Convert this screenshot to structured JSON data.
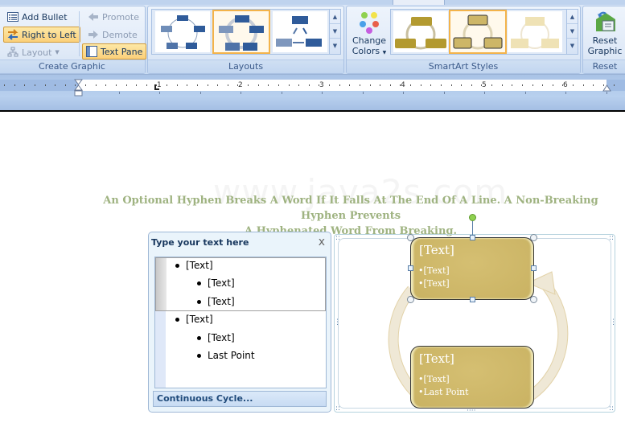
{
  "ribbon": {
    "create_graphic": {
      "label": "Create Graphic",
      "add_bullet": "Add Bullet",
      "right_to_left": "Right to Left",
      "layout": "Layout",
      "promote": "Promote",
      "demote": "Demote",
      "text_pane": "Text Pane"
    },
    "layouts": {
      "label": "Layouts",
      "thumbs": [
        "Basic Cycle",
        "Continuous Cycle",
        "Hierarchy Cycle"
      ],
      "selected_index": 1
    },
    "smartart_styles": {
      "label": "SmartArt Styles",
      "change_colors_l1": "Change",
      "change_colors_l2": "Colors",
      "thumbs": [
        "Style 1",
        "Style 2",
        "Style 3"
      ],
      "selected_index": 1
    },
    "reset": {
      "label": "Reset",
      "reset_graphic_l1": "Reset",
      "reset_graphic_l2": "Graphic"
    }
  },
  "ruler": {
    "numbers": [
      "1",
      "2",
      "3",
      "4",
      "5",
      "6"
    ]
  },
  "document": {
    "watermark": "www.java2s.com",
    "heading_line1": "An Optional Hyphen Breaks A Word If It Falls At The End Of A Line. A Non-Breaking Hyphen Prevents",
    "heading_line2": "A Hyphenated  Word From Breaking."
  },
  "text_pane": {
    "title": "Type your text here",
    "close": "x",
    "items": [
      {
        "level": 1,
        "text": "[Text]"
      },
      {
        "level": 2,
        "text": "[Text]"
      },
      {
        "level": 2,
        "text": "[Text]"
      },
      {
        "level": 1,
        "text": "[Text]"
      },
      {
        "level": 2,
        "text": "[Text]"
      },
      {
        "level": 2,
        "text": "Last Point"
      }
    ],
    "footer": "Continuous Cycle..."
  },
  "smartart": {
    "shapes": [
      {
        "title": "[Text]",
        "bullets": [
          "•[Text]",
          "•[Text]"
        ]
      },
      {
        "title": "[Text]",
        "bullets": [
          "•[Text]",
          "•Last Point"
        ]
      }
    ],
    "colors": {
      "shape_fill": "#cdb667",
      "arrow": "#eee6d2",
      "accent": "#f3b34a"
    }
  }
}
